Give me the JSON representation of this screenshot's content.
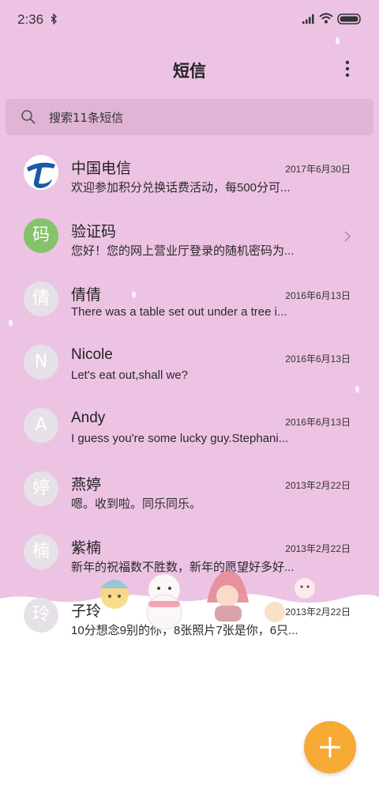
{
  "status_bar": {
    "time": "2:36"
  },
  "header": {
    "title": "短信"
  },
  "search": {
    "placeholder": "搜索11条短信"
  },
  "conversations": [
    {
      "avatar": "",
      "name": "中国电信",
      "preview": "欢迎参加积分兑换话费活动，每500分可...",
      "date": "2017年6月30日"
    },
    {
      "avatar": "码",
      "name": "验证码",
      "preview": "您好！您的网上营业厅登录的随机密码为...",
      "date": ""
    },
    {
      "avatar": "倩",
      "name": "倩倩",
      "preview": "There was a table set out under a tree i...",
      "date": "2016年6月13日"
    },
    {
      "avatar": "N",
      "name": "Nicole",
      "preview": "Let's eat out,shall we?",
      "date": "2016年6月13日"
    },
    {
      "avatar": "A",
      "name": "Andy",
      "preview": "I guess you're some lucky guy.Stephani...",
      "date": "2016年6月13日"
    },
    {
      "avatar": "婷",
      "name": "燕婷",
      "preview": "嗯。收到啦。同乐同乐。",
      "date": "2013年2月22日"
    },
    {
      "avatar": "楠",
      "name": "紫楠",
      "preview": "新年的祝福数不胜数，新年的愿望好多好...",
      "date": "2013年2月22日"
    },
    {
      "avatar": "玲",
      "name": "子玲",
      "preview": "10分想念9别的你，8张照片7张是你，6只...",
      "date": "2013年2月22日"
    }
  ],
  "colors": {
    "background": "#edc3e4",
    "search_bg": "#dfb4d5",
    "fab": "#f6a935",
    "verify_avatar": "#86c26c"
  },
  "icons": {
    "more": "more-vert-icon",
    "search": "search-icon",
    "fab": "plus-icon"
  }
}
